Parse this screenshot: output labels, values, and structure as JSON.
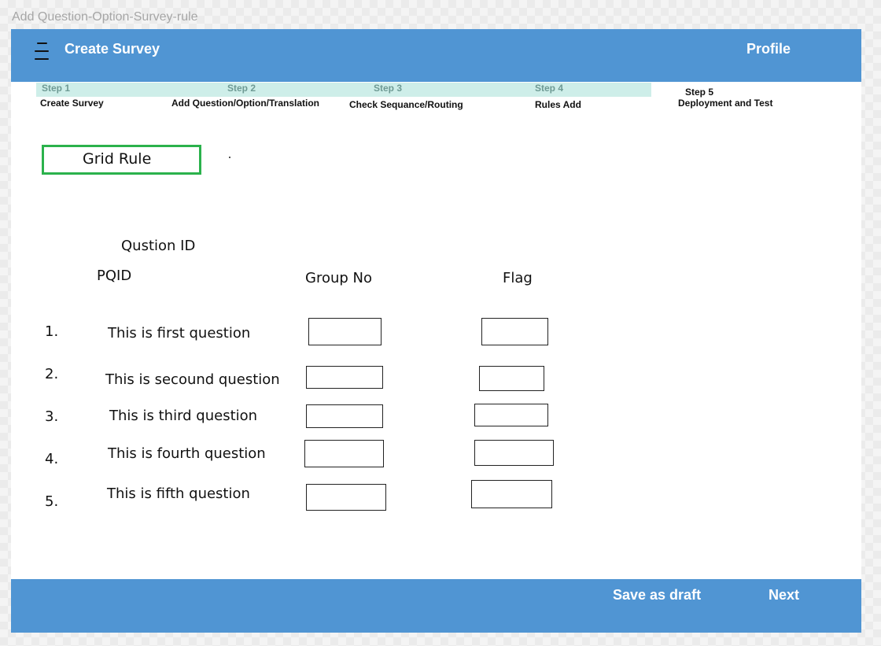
{
  "window": {
    "title": "Add Question-Option-Survey-rule"
  },
  "header": {
    "title": "Create Survey",
    "profile_label": "Profile",
    "menu_icon": "hamburger-menu-icon"
  },
  "steps": [
    {
      "number": "Step 1",
      "name": "Create Survey"
    },
    {
      "number": "Step 2",
      "name": "Add Question/Option/Translation"
    },
    {
      "number": "Step 3",
      "name": "Check Sequance/Routing"
    },
    {
      "number": "Step 4",
      "name": "Rules Add"
    },
    {
      "number": "Step 5",
      "name": "Deployment and Test"
    }
  ],
  "section": {
    "title": "Grid Rule"
  },
  "columns": {
    "question_id": "Qustion ID",
    "pqid": "PQID",
    "group_no": "Group No",
    "flag": "Flag"
  },
  "rows": [
    {
      "num": "1.",
      "text": "This is first question",
      "group_no": "",
      "flag": ""
    },
    {
      "num": "2.",
      "text": "This is secound question",
      "group_no": "",
      "flag": ""
    },
    {
      "num": "3.",
      "text": "This is third question",
      "group_no": "",
      "flag": ""
    },
    {
      "num": "4.",
      "text": "This is fourth question",
      "group_no": "",
      "flag": ""
    },
    {
      "num": "5.",
      "text": "This is fifth question",
      "group_no": "",
      "flag": ""
    }
  ],
  "footer": {
    "save_draft_label": "Save as draft",
    "next_label": "Next"
  },
  "colors": {
    "header_bg": "#5095d3",
    "steps_bar_bg": "#ceeee9",
    "section_border": "#2bb24c"
  }
}
